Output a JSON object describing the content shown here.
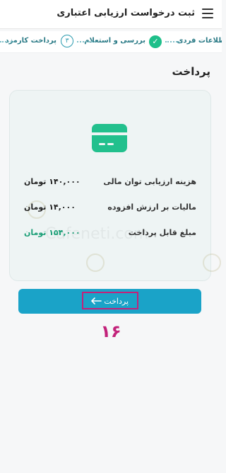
{
  "header": {
    "title": "ثبت درخواست ارزیابی اعتباری",
    "menu_icon": "hamburger-menu-icon"
  },
  "stepper": {
    "step1_label": "اطلاعات فردی",
    "step2_label": "بررسی و استعلام",
    "step3_label": "پرداخت کارمزد",
    "step3_number": "۳",
    "check_icon": "check-icon",
    "completed_color": "#1ebf8a",
    "active_color": "#2a9aae"
  },
  "page": {
    "title": "پرداخت"
  },
  "card": {
    "icon": "credit-card-icon",
    "rows": [
      {
        "label": "هزینه ارزیابی توان مالی",
        "value": "۱۴۰,۰۰۰ تومان"
      },
      {
        "label": "مالیات بر ارزش افزوده",
        "value": "۱۴,۰۰۰ تومان"
      },
      {
        "label": "مبلغ قابل پرداخت",
        "value": "۱۵۴,۰۰۰ تومان"
      }
    ]
  },
  "pay_button": {
    "label": "پرداخت",
    "icon": "arrow-left-icon",
    "color": "#1aa3c8"
  },
  "annotation": {
    "text": "۱۶",
    "color": "#c2227a"
  }
}
